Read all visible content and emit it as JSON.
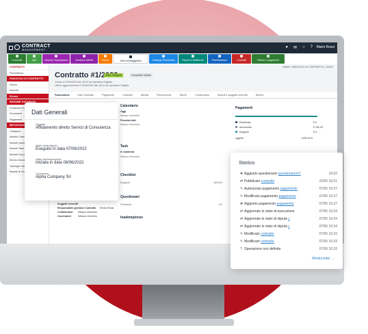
{
  "app": {
    "logo_line1": "CONTRACT",
    "logo_line2": "MANAGEMENT",
    "user": "Mario Rossi"
  },
  "modules": [
    {
      "label": "Cruscotto",
      "color": "#2e7d32"
    },
    {
      "label": "Albi",
      "color": "#43a047"
    },
    {
      "label": "Gestore Impostazioni",
      "color": "#9c27b0"
    },
    {
      "label": "Gestione Attività",
      "color": "#8e24aa"
    },
    {
      "label": "Report",
      "color": "#f57c00"
    },
    {
      "label": "Area messaggistica",
      "color": "#ffffff"
    },
    {
      "label": "Catalogo Preliminare",
      "color": "#1e88e5"
    },
    {
      "label": "Report & Statistiche",
      "color": "#00897b"
    },
    {
      "label": "Pianificazione",
      "color": "#1565c0"
    },
    {
      "label": "Contratti",
      "color": "#c62828"
    },
    {
      "label": "Fatture e pagamenti",
      "color": "#2e7d32"
    }
  ],
  "sidebar": {
    "items": [
      {
        "label": "CONTRATTI",
        "style": "head"
      },
      {
        "label": "Panoramica",
        "style": ""
      },
      {
        "label": "FASCICOLI DI CONTRATTO",
        "style": "red"
      },
      {
        "label": "Nuovo",
        "style": ""
      },
      {
        "label": "Importa",
        "style": ""
      },
      {
        "label": "Elenco",
        "style": "red"
      },
      {
        "label": "SEZIONE DATABASE",
        "style": "red"
      },
      {
        "label": "Portavoce Enti",
        "style": ""
      },
      {
        "label": "Documenti",
        "style": ""
      },
      {
        "label": "Pagamenti",
        "style": ""
      },
      {
        "label": "IMPOSTAZIONI",
        "style": "red"
      },
      {
        "label": "Categorie",
        "style": ""
      },
      {
        "label": "Modelli Checklist",
        "style": ""
      },
      {
        "label": "Modelli Questionari",
        "style": ""
      },
      {
        "label": "Modelli Task",
        "style": ""
      },
      {
        "label": "Modelli Documenti",
        "style": ""
      },
      {
        "label": "Elenco Documenti",
        "style": ""
      },
      {
        "label": "Tipologie relazioni tra contratti",
        "style": ""
      },
      {
        "label": "Modelli di Soggetti Coinvolti",
        "style": ""
      }
    ]
  },
  "main": {
    "breadcrumb": "HOME / FASCICOLI DI CONTRATTO / 1/2022",
    "title": "Contratto #1/2022",
    "badge_status": "Stato: Eseguito",
    "badge_consultant": "Consultare Iniziale",
    "sub1": "Creato il 07/06/2022 alle 16:03 da Operatore Digitale",
    "sub2": "Ultimo aggiornamento il 22/06/2022 alle 16:51 da Operatore Digitale",
    "tabs": [
      "Panoramica",
      "Dati Contratto",
      "Pagamenti",
      "Contratti",
      "Attività",
      "Performance",
      "Rischi",
      "Contenzioso",
      "Moduli e soggetti coinvolti",
      "Storico"
    ],
    "calendario": "Calendario",
    "oggi": "Oggi",
    "nessun": "Nessun elemento",
    "prossimi": "Prossimi dati",
    "task": "Task",
    "in_scadenza": "In scadenza",
    "checklist": "Checklist",
    "eseguito": "Eseguito",
    "checklist_val": "16/2000",
    "questionari": "Questionari",
    "pertinente": "Pertinente",
    "quest_val": "0/0",
    "inadempienze": "Inadempienze",
    "pagamenti": "Pagamenti",
    "pag_rows": [
      {
        "label": "Pianificato",
        "val": "€ 0",
        "color": "#1e2a38"
      },
      {
        "label": "Autorizzato",
        "val": "€ 150,00",
        "color": "#6b7785"
      },
      {
        "label": "Eseguito",
        "val": "€ 0",
        "color": "#1b8a89"
      }
    ],
    "oggetto_label": "oggetto",
    "oggetto_val": "1.800,00 €",
    "soggetti": "Soggetti coinvolti",
    "resp": "Responsabile gestione Contratto",
    "resp_val": "Enrico Rossi",
    "collab": "Collaboratori",
    "collab_val": "Nessun elemento",
    "osserv": "Osservatori",
    "osserv_val": "Nessun elemento"
  },
  "dati_generali": {
    "header": "Dati Generali",
    "oggetto_label": "Oggetto",
    "oggetto_value": "Affidamento diretto Servizi di Consulenza",
    "stato_stipula_label": "Stato della stipula",
    "stato_stipula_value": "Eseguito in data 07/06/2022",
    "stato_esecuzione_label": "Stato dell'esecuzione",
    "stato_esecuzione_value": "Iniziata in data 08/06/2022",
    "contraenti_label": "Contraenti",
    "contraenti_value": "Alpha Company Srl"
  },
  "storico": {
    "header": "Storico",
    "rows": [
      {
        "icon": "✚",
        "text": "Aggiunto questionario",
        "link": "questionario#1",
        "time": "10:02"
      },
      {
        "icon": "⇄",
        "text": "Pubblicato",
        "link": "contratto",
        "time": "22/06 16:51"
      },
      {
        "icon": "✎",
        "text": "Autorizzato pagamento",
        "link": "pagamento",
        "time": "07/06 16:37"
      },
      {
        "icon": "✎",
        "text": "Modificato pagamento",
        "link": "pagamento",
        "time": "07/06 16:37"
      },
      {
        "icon": "✚",
        "text": "Aggiunto pagamento",
        "link": "pagamento",
        "time": "07/06 16:37"
      },
      {
        "icon": "⇄",
        "text": "Aggiornato lo stato di esecuzione",
        "link": "",
        "time": "07/06 16:34"
      },
      {
        "icon": "⇄",
        "text": "Aggiornato lo stato di stipula",
        "link": "c",
        "time": "07/06 16:34"
      },
      {
        "icon": "⇄",
        "text": "Aggiornato lo stato di stipula",
        "link": "c",
        "time": "07/06 16:34"
      },
      {
        "icon": "✎",
        "text": "Modificato",
        "link": "contratto",
        "time": "07/06 16:33"
      },
      {
        "icon": "✎",
        "text": "Modificato",
        "link": "contratto",
        "time": "07/06 16:33"
      },
      {
        "icon": "?",
        "text": "Operazione non definita",
        "link": "",
        "time": "07/06 16:33"
      }
    ],
    "more": "Mostra tutto →"
  }
}
